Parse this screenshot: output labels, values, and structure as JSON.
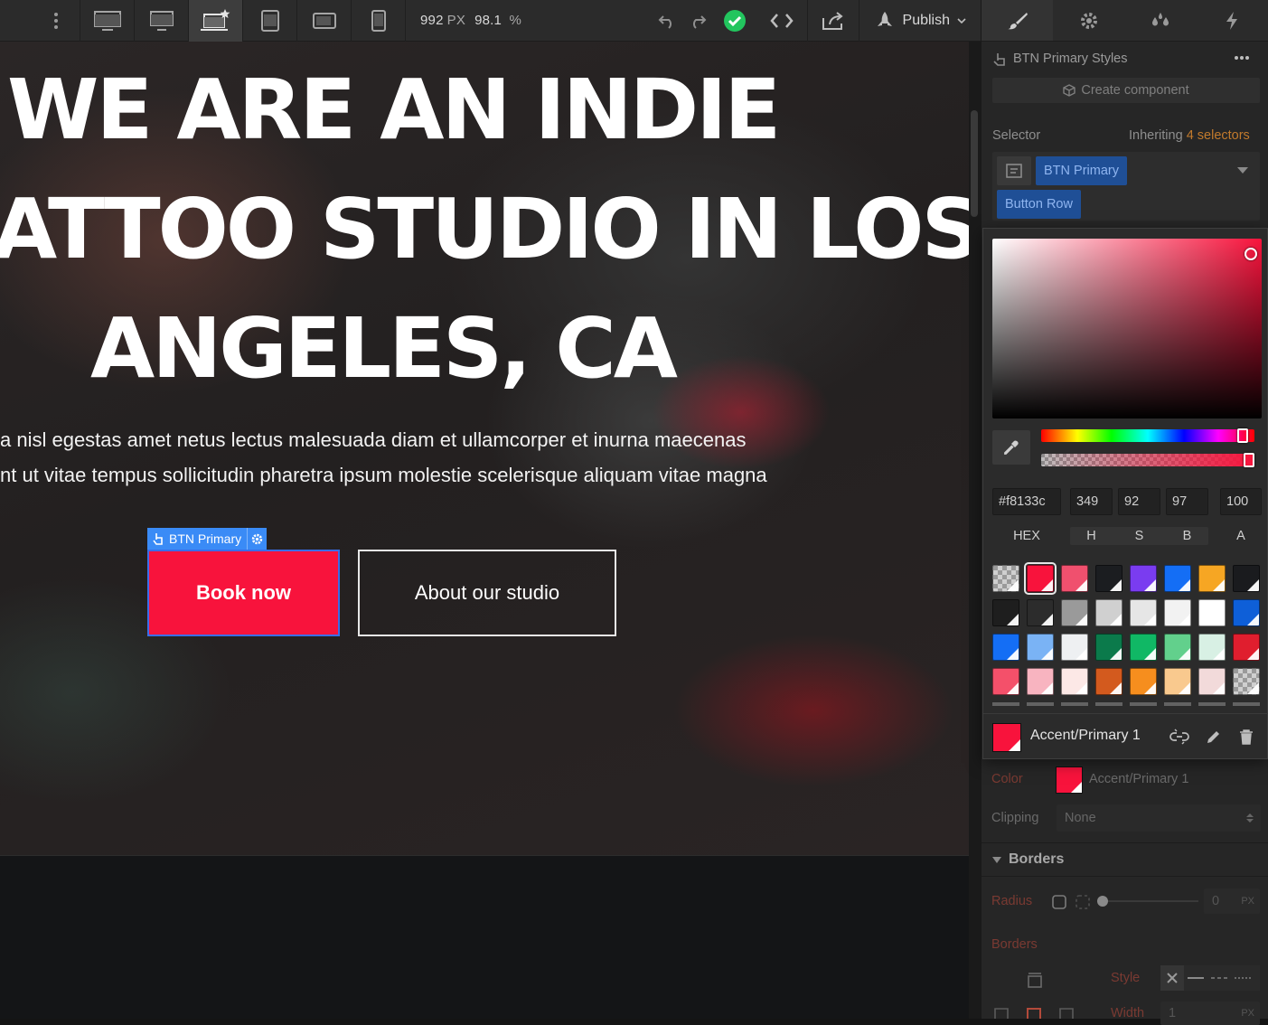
{
  "topbar": {
    "width_value": "992",
    "width_unit": "PX",
    "zoom_value": "98.1",
    "zoom_unit": "%",
    "publish_label": "Publish",
    "devices": [
      "desktop-wide-icon",
      "desktop-icon",
      "laptop-base-icon",
      "tablet-icon",
      "mobile-landscape-icon",
      "mobile-portrait-icon"
    ],
    "active_device": "laptop-base-icon",
    "status_color": "#2ecc71"
  },
  "hero": {
    "line1": "WE ARE AN INDIE",
    "line2": "ATTOO STUDIO IN LOS",
    "line3": "ANGELES, CA",
    "para1": "a nisl egestas amet netus lectus malesuada diam et ullamcorper et inurna maecenas",
    "para2": "nt ut vitae tempus sollicitudin pharetra ipsum molestie scelerisque aliquam vitae magna",
    "selected_tag": "BTN Primary",
    "btn_primary": "Book now",
    "btn_secondary": "About our studio",
    "accent_color": "#f8133c"
  },
  "panel": {
    "styles_title": "BTN Primary Styles",
    "create_component": "Create component",
    "selector_label": "Selector",
    "inheriting_prefix": "Inheriting",
    "inheriting_count": "4 selectors",
    "chip_primary": "BTN Primary",
    "chip_row": "Button Row",
    "color_label": "Color",
    "color_value": "Accent/Primary 1",
    "clipping_label": "Clipping",
    "clipping_value": "None",
    "borders_title": "Borders",
    "radius_label": "Radius",
    "radius_value": "0",
    "radius_unit": "PX",
    "borders_label": "Borders",
    "style_label": "Style",
    "width_label": "Width",
    "width_value": "1",
    "width_unit": "PX"
  },
  "picker": {
    "hex": "#f8133c",
    "h": "349",
    "s": "92",
    "b": "97",
    "a": "100",
    "labels": {
      "hex": "HEX",
      "h": "H",
      "s": "S",
      "b": "B",
      "a": "A"
    },
    "hue_fraction": 0.97,
    "alpha_fraction": 1.0,
    "variable_name": "Accent/Primary 1",
    "swatches": [
      "checker",
      "#f8133c",
      "#f0506e",
      "#1b1d20",
      "#7a3cf0",
      "#146ef5",
      "#f6a623",
      "#1a1b1e",
      "#1e1e1e",
      "#2c2c2c",
      "#9a9a9a",
      "#d0d0d0",
      "#e6e6e6",
      "#f2f2f2",
      "#ffffff",
      "#0e5fd8",
      "#146ef5",
      "#7ab3f5",
      "#eef0f2",
      "#0b7a4b",
      "#10b865",
      "#62d08c",
      "#d8f0e4",
      "#e01e2e",
      "#f4506a",
      "#f8b4c0",
      "#fce8e6",
      "#d35a1e",
      "#f68e1e",
      "#f9c98e",
      "#f2dada",
      "checker"
    ],
    "selected_swatch": 1
  }
}
